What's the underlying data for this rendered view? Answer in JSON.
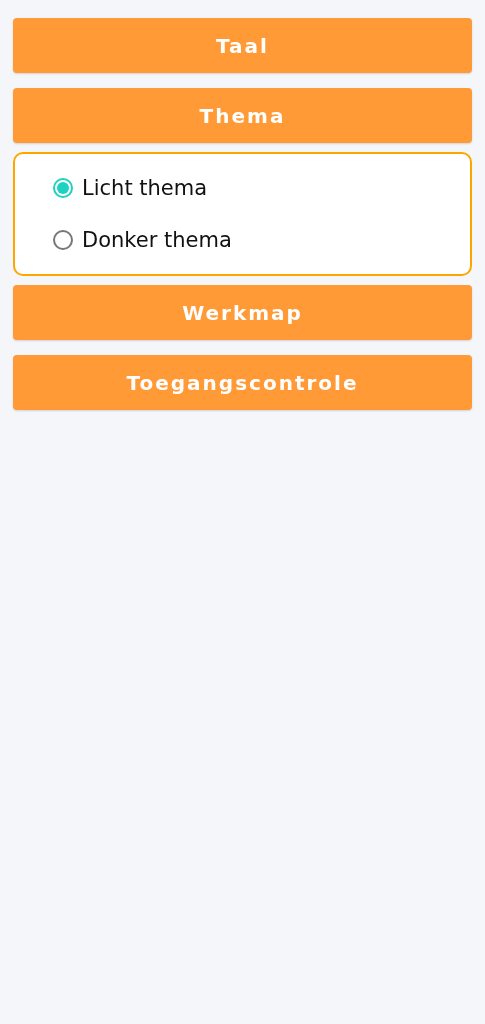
{
  "sections": [
    {
      "label": "Taal"
    },
    {
      "label": "Thema",
      "options": [
        {
          "label": "Licht thema",
          "selected": true
        },
        {
          "label": "Donker thema",
          "selected": false
        }
      ]
    },
    {
      "label": "Werkmap"
    },
    {
      "label": "Toegangscontrole"
    }
  ]
}
